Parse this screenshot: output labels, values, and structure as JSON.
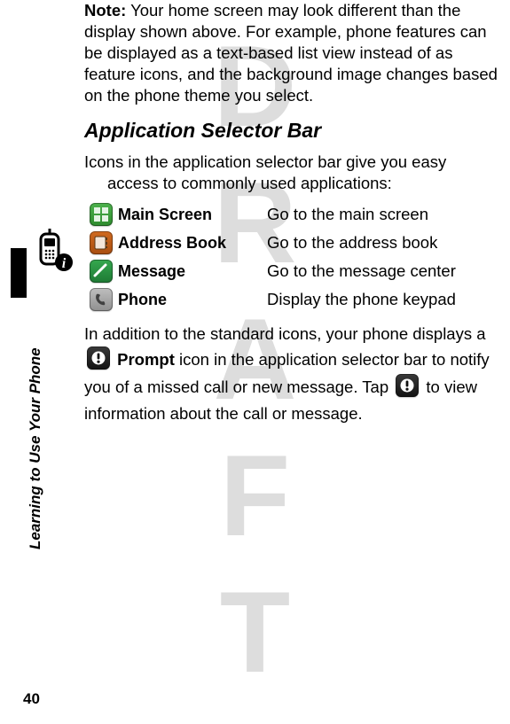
{
  "watermark": "DRAFT",
  "sideLabel": "Learning to Use Your Phone",
  "pageNumber": "40",
  "note": {
    "label": "Note:",
    "text": " Your home screen may look different than the display shown above. For example, phone features can be displayed as a text-based list view instead of as feature icons, and the background image changes based on the phone theme you select."
  },
  "heading": "Application Selector Bar",
  "intro": "Icons in the application selector bar give you easy access to commonly used applications:",
  "rows": [
    {
      "label": "Main Screen",
      "desc": "Go to the main screen"
    },
    {
      "label": "Address Book",
      "desc": "Go to the address book"
    },
    {
      "label": "Message",
      "desc": "Go to the message center"
    },
    {
      "label": "Phone",
      "desc": "Display the phone keypad"
    }
  ],
  "prompt": {
    "lead": "In addition to the standard icons, your phone displays a ",
    "iconLabel": "Prompt",
    "tail1": " icon in the application selector bar to notify you of a missed call or new message. Tap ",
    "tail2": " to view information about the call or message."
  }
}
